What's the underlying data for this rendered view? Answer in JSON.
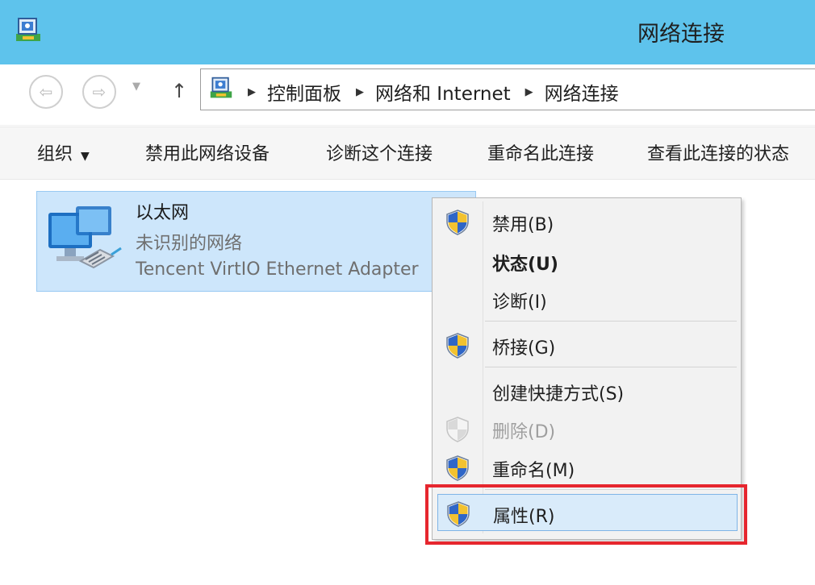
{
  "window": {
    "title": "网络连接"
  },
  "address": {
    "crumbs": [
      "控制面板",
      "网络和 Internet",
      "网络连接"
    ]
  },
  "toolbar": {
    "organize": "组织",
    "disable": "禁用此网络设备",
    "diagnose": "诊断这个连接",
    "rename": "重命名此连接",
    "view_status": "查看此连接的状态"
  },
  "connection": {
    "name": "以太网",
    "status": "未识别的网络",
    "adapter": "Tencent VirtIO Ethernet Adapter"
  },
  "context_menu": {
    "items": [
      {
        "label": "禁用(B)",
        "shield": true
      },
      {
        "label": "状态(U)",
        "bold": true
      },
      {
        "label": "诊断(I)"
      },
      {
        "label": "桥接(G)",
        "shield": true
      },
      {
        "label": "创建快捷方式(S)"
      },
      {
        "label": "删除(D)",
        "disabled": true,
        "shield": true
      },
      {
        "label": "重命名(M)",
        "shield": true
      },
      {
        "label": "属性(R)",
        "shield": true,
        "highlighted": true
      }
    ]
  },
  "colors": {
    "titlebar": "#5ec3ec",
    "selection": "#cde6fb",
    "callout": "#e6262e"
  }
}
